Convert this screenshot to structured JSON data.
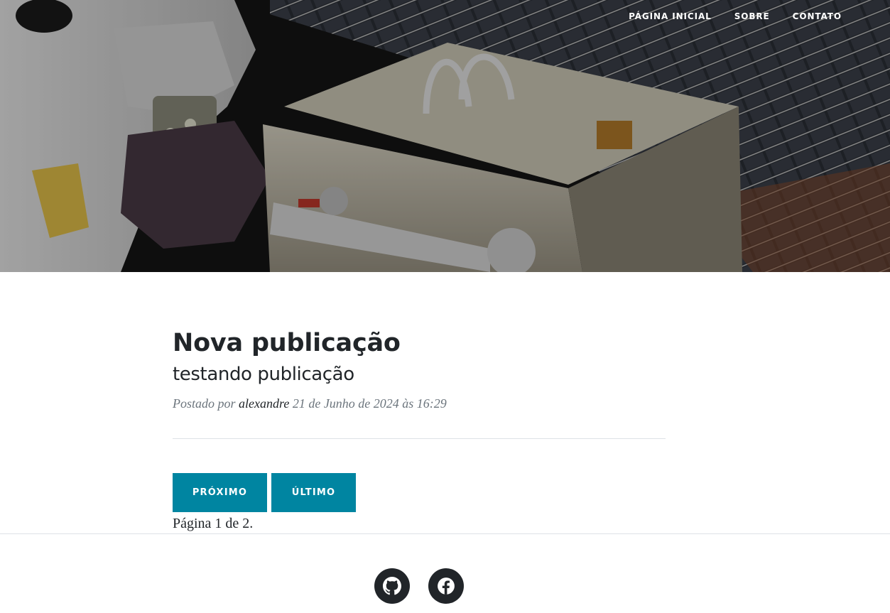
{
  "nav": {
    "home": "PÁGINA INICIAL",
    "about": "SOBRE",
    "contact": "CONTATO"
  },
  "post": {
    "title": "Nova publicação",
    "subtitle": "testando publicação",
    "meta_prefix": "Postado por",
    "author": "alexandre",
    "date": "21 de Junho de 2024 às 16:29"
  },
  "pager": {
    "next_label": "PRÓXIMO",
    "last_label": "ÚLTIMO",
    "page_info": "Página 1 de 2."
  },
  "footer": {
    "icons": [
      "github-icon",
      "facebook-icon"
    ]
  },
  "colors": {
    "accent": "#0085a1",
    "text": "#212529",
    "muted": "#6c757d",
    "divider": "#dee2e6"
  }
}
